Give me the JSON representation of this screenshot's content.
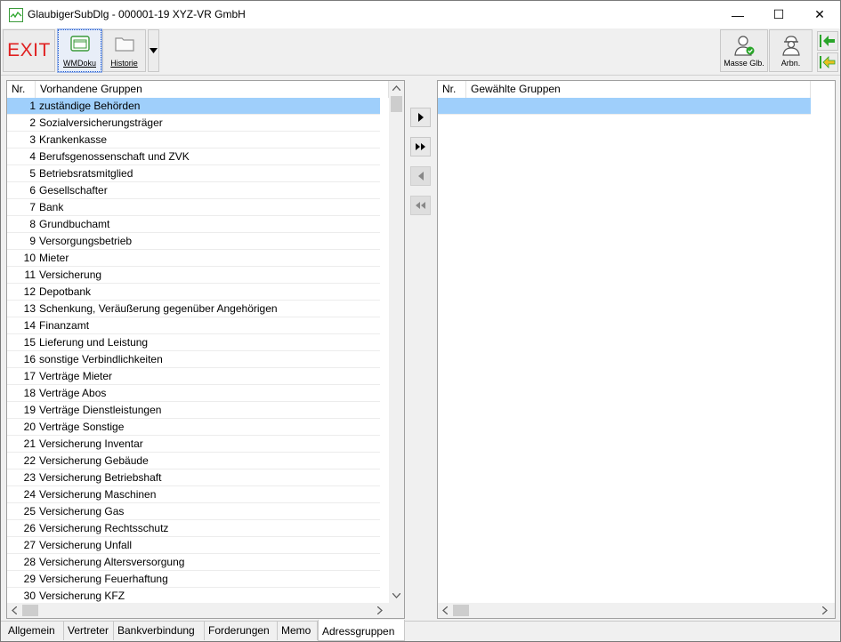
{
  "window": {
    "title": "GlaubigerSubDlg - 000001-19 XYZ-VR GmbH",
    "minimize_glyph": "—",
    "maximize_glyph": "☐",
    "close_glyph": "✕"
  },
  "toolbar": {
    "exit_label": "EXIT",
    "wmdoku_label": "WMDoku",
    "historie_label": "Historie",
    "masse_label": "Masse Glb.",
    "arbn_label": "Arbn.",
    "accent_green": "#2aa52a"
  },
  "left_list": {
    "col_nr": "Nr.",
    "col_name": "Vorhandene Gruppen",
    "selected_color": "#9fcffb",
    "rows": [
      {
        "nr": "1",
        "name": "zuständige Behörden",
        "selected": true
      },
      {
        "nr": "2",
        "name": "Sozialversicherungsträger"
      },
      {
        "nr": "3",
        "name": "Krankenkasse"
      },
      {
        "nr": "4",
        "name": "Berufsgenossenschaft und ZVK"
      },
      {
        "nr": "5",
        "name": "Betriebsratsmitglied"
      },
      {
        "nr": "6",
        "name": "Gesellschafter"
      },
      {
        "nr": "7",
        "name": "Bank"
      },
      {
        "nr": "8",
        "name": "Grundbuchamt"
      },
      {
        "nr": "9",
        "name": "Versorgungsbetrieb"
      },
      {
        "nr": "10",
        "name": "Mieter"
      },
      {
        "nr": "11",
        "name": "Versicherung"
      },
      {
        "nr": "12",
        "name": "Depotbank"
      },
      {
        "nr": "13",
        "name": "Schenkung, Veräußerung gegenüber Angehörigen"
      },
      {
        "nr": "14",
        "name": "Finanzamt"
      },
      {
        "nr": "15",
        "name": "Lieferung und Leistung"
      },
      {
        "nr": "16",
        "name": "sonstige Verbindlichkeiten"
      },
      {
        "nr": "17",
        "name": "Verträge Mieter"
      },
      {
        "nr": "18",
        "name": "Verträge Abos"
      },
      {
        "nr": "19",
        "name": "Verträge Dienstleistungen"
      },
      {
        "nr": "20",
        "name": "Verträge Sonstige"
      },
      {
        "nr": "21",
        "name": "Versicherung Inventar"
      },
      {
        "nr": "22",
        "name": "Versicherung Gebäude"
      },
      {
        "nr": "23",
        "name": "Versicherung Betriebshaft"
      },
      {
        "nr": "24",
        "name": "Versicherung Maschinen"
      },
      {
        "nr": "25",
        "name": "Versicherung Gas"
      },
      {
        "nr": "26",
        "name": "Versicherung Rechtsschutz"
      },
      {
        "nr": "27",
        "name": "Versicherung Unfall"
      },
      {
        "nr": "28",
        "name": "Versicherung Altersversorgung"
      },
      {
        "nr": "29",
        "name": "Versicherung Feuerhaftung"
      },
      {
        "nr": "30",
        "name": "Versicherung KFZ"
      }
    ]
  },
  "right_list": {
    "col_nr": "Nr.",
    "col_name": "Gewählte Gruppen"
  },
  "move_buttons": {
    "add_glyph": "▶",
    "add_all_glyph": "▶▶",
    "remove_glyph": "◀",
    "remove_all_glyph": "◀◀"
  },
  "tabs": [
    {
      "label": "Allgemein"
    },
    {
      "label": "Vertreter"
    },
    {
      "label": "Bankverbindung"
    },
    {
      "label": "Forderungen"
    },
    {
      "label": "Memo"
    },
    {
      "label": "Adressgruppen",
      "active": true
    }
  ]
}
